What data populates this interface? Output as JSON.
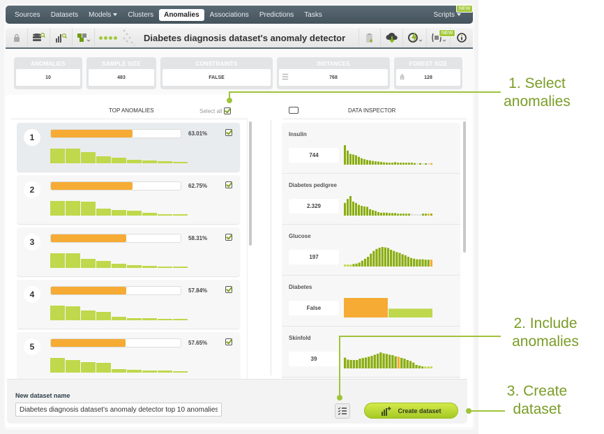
{
  "nav": {
    "items": [
      "Sources",
      "Datasets",
      "Models",
      "Clusters",
      "Anomalies",
      "Associations",
      "Predictions",
      "Tasks"
    ],
    "active": "Anomalies",
    "scripts": "Scripts",
    "new_badge": "NEW"
  },
  "toolbar": {
    "title": "Diabetes diagnosis dataset's anomaly detector",
    "new_badge": "NEW"
  },
  "stats": [
    {
      "label": "ANOMALIES",
      "value": "10"
    },
    {
      "label": "SAMPLE SIZE",
      "value": "483"
    },
    {
      "label": "CONSTRAINTS",
      "value": "FALSE"
    },
    {
      "label": "INSTANCES",
      "value": "768"
    },
    {
      "label": "FOREST SIZE",
      "value": "128"
    }
  ],
  "top_anomalies": {
    "header": "TOP ANOMALIES",
    "select_all": "Select all",
    "items": [
      {
        "rank": "1",
        "score_label": "63.01%",
        "score": 0.6301,
        "bars": [
          1.0,
          1.0,
          0.77,
          0.5,
          0.38,
          0.22,
          0.17,
          0.12,
          0.05
        ],
        "checked": true
      },
      {
        "rank": "2",
        "score_label": "62.75%",
        "score": 0.6275,
        "bars": [
          1.0,
          1.0,
          0.95,
          0.5,
          0.4,
          0.35,
          0.17,
          0.08,
          0.08
        ],
        "checked": true
      },
      {
        "rank": "3",
        "score_label": "58.31%",
        "score": 0.5831,
        "bars": [
          1.0,
          0.98,
          0.63,
          0.5,
          0.27,
          0.18,
          0.14,
          0.08,
          0.08
        ],
        "checked": true
      },
      {
        "rank": "4",
        "score_label": "57.84%",
        "score": 0.5784,
        "bars": [
          1.0,
          0.95,
          0.65,
          0.58,
          0.26,
          0.16,
          0.12,
          0.08,
          0.08
        ],
        "checked": true
      },
      {
        "rank": "5",
        "score_label": "57.65%",
        "score": 0.5765,
        "bars": [
          1.0,
          0.87,
          0.7,
          0.66,
          0.22,
          0.18,
          0.15,
          0.13,
          0.06
        ],
        "checked": true
      }
    ]
  },
  "data_inspector": {
    "header": "DATA INSPECTOR",
    "fields": [
      {
        "name": "Insulin",
        "value": "744",
        "hist": [
          1,
          0.72,
          0.55,
          0.52,
          0.48,
          0.4,
          0.33,
          0.28,
          0.24,
          0.22,
          0.19,
          0.17,
          0.16,
          0.14,
          0.12,
          0.11,
          0.1,
          0.1,
          0.13,
          0.1,
          0.1,
          0.1,
          0.1,
          0.1,
          0.1,
          0.08,
          0.06,
          0.08,
          0.06,
          0.06,
          0.08,
          0.08
        ],
        "hist_colors": "insulin"
      },
      {
        "name": "Diabetes pedigree",
        "value": "2.329",
        "hist": [
          0.65,
          0.85,
          1,
          0.72,
          0.65,
          0.55,
          0.5,
          0.47,
          0.45,
          0.33,
          0.28,
          0.24,
          0.18,
          0.15,
          0.15,
          0.15,
          0.13,
          0.13,
          0.13,
          0.1,
          0.1,
          0.1,
          0.1,
          0.1,
          0.1,
          0.06,
          0.06,
          0.06,
          0.1,
          0.1,
          0.1,
          0.1
        ],
        "hist_colors": "pedigree"
      },
      {
        "name": "Glucose",
        "value": "197",
        "hist": [
          0.1,
          0.1,
          0.1,
          0.13,
          0.15,
          0.2,
          0.3,
          0.4,
          0.5,
          0.66,
          0.8,
          0.9,
          0.96,
          1,
          0.98,
          0.95,
          0.86,
          0.8,
          0.74,
          0.7,
          0.63,
          0.58,
          0.5,
          0.44,
          0.4,
          0.37,
          0.37,
          0.37,
          0.35,
          0.35,
          0.35
        ],
        "hist_colors": "glucose"
      },
      {
        "name": "Diabetes",
        "value": "False",
        "hist": [
          1,
          0.45
        ],
        "hist_colors": "diabetes"
      },
      {
        "name": "Skinfold",
        "value": "39",
        "hist": [
          0.55,
          0.45,
          0.43,
          0.43,
          0.43,
          0.5,
          0.53,
          0.56,
          0.6,
          0.64,
          0.7,
          0.75,
          0.82,
          0.77,
          0.74,
          0.7,
          0.68,
          0.62,
          0.6,
          0.54,
          0.5,
          0.43,
          0.38,
          0.3,
          0.18,
          0.14,
          0.1,
          0.1,
          0.1,
          0.1
        ],
        "hist_colors": "skinfold"
      }
    ]
  },
  "bottom": {
    "dataset_name_label": "New dataset name",
    "dataset_name_value": "Diabetes diagnosis dataset's anomaly detector top 10 anomalies",
    "create_label": "Create dataset"
  },
  "annotations": {
    "step1_line1": "1. Select",
    "step1_line2": "anomalies",
    "step2_line1": "2. Include",
    "step2_line2": "anomalies",
    "step3_line1": "3. Create",
    "step3_line2": "dataset"
  },
  "colors": {
    "accent_green": "#a3c93a",
    "bar_green": "#bfd84c",
    "dark_green": "#8aad10",
    "orange": "#f5ab34",
    "nav_bg": "#4f5f68",
    "annotation": "#7a9d27"
  }
}
